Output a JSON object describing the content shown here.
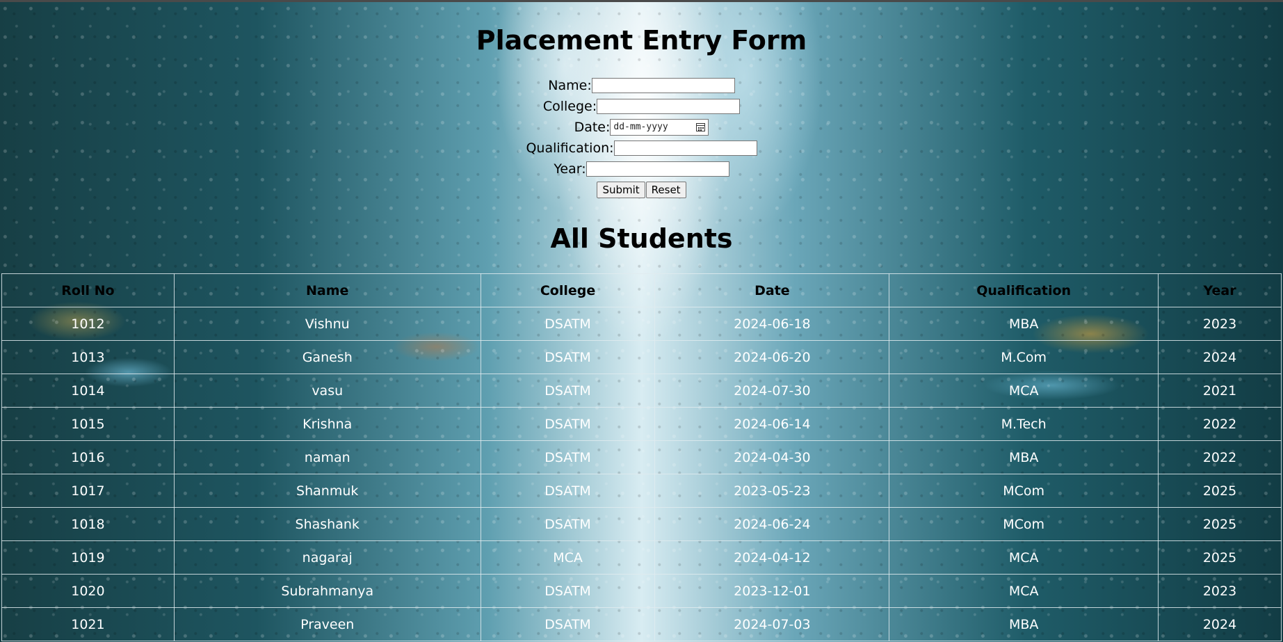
{
  "form": {
    "title": "Placement Entry Form",
    "name_label": "Name:",
    "name_value": "",
    "college_label": "College:",
    "college_value": "",
    "date_label": "Date:",
    "date_placeholder": "dd-mm-yyyy",
    "qualification_label": "Qualification:",
    "qualification_value": "",
    "year_label": "Year:",
    "year_value": "",
    "submit_label": "Submit",
    "reset_label": "Reset"
  },
  "table": {
    "title": "All Students",
    "headers": [
      "Roll No",
      "Name",
      "College",
      "Date",
      "Qualification",
      "Year"
    ],
    "rows": [
      [
        "1012",
        "Vishnu",
        "DSATM",
        "2024-06-18",
        "MBA",
        "2023"
      ],
      [
        "1013",
        "Ganesh",
        "DSATM",
        "2024-06-20",
        "M.Com",
        "2024"
      ],
      [
        "1014",
        "vasu",
        "DSATM",
        "2024-07-30",
        "MCA",
        "2021"
      ],
      [
        "1015",
        "Krishna",
        "DSATM",
        "2024-06-14",
        "M.Tech",
        "2022"
      ],
      [
        "1016",
        "naman",
        "DSATM",
        "2024-04-30",
        "MBA",
        "2022"
      ],
      [
        "1017",
        "Shanmuk",
        "DSATM",
        "2023-05-23",
        "MCom",
        "2025"
      ],
      [
        "1018",
        "Shashank",
        "DSATM",
        "2024-06-24",
        "MCom",
        "2025"
      ],
      [
        "1019",
        "nagaraj",
        "MCA",
        "2024-04-12",
        "MCA",
        "2025"
      ],
      [
        "1020",
        "Subrahmanya",
        "DSATM",
        "2023-12-01",
        "MCA",
        "2023"
      ],
      [
        "1021",
        "Praveen",
        "DSATM",
        "2024-07-03",
        "MBA",
        "2024"
      ]
    ]
  },
  "colors": {
    "header_text": "#000000",
    "cell_text": "#ffffff",
    "grid_line": "#e1ebee"
  },
  "icons": {
    "date_picker": "calendar-icon"
  }
}
